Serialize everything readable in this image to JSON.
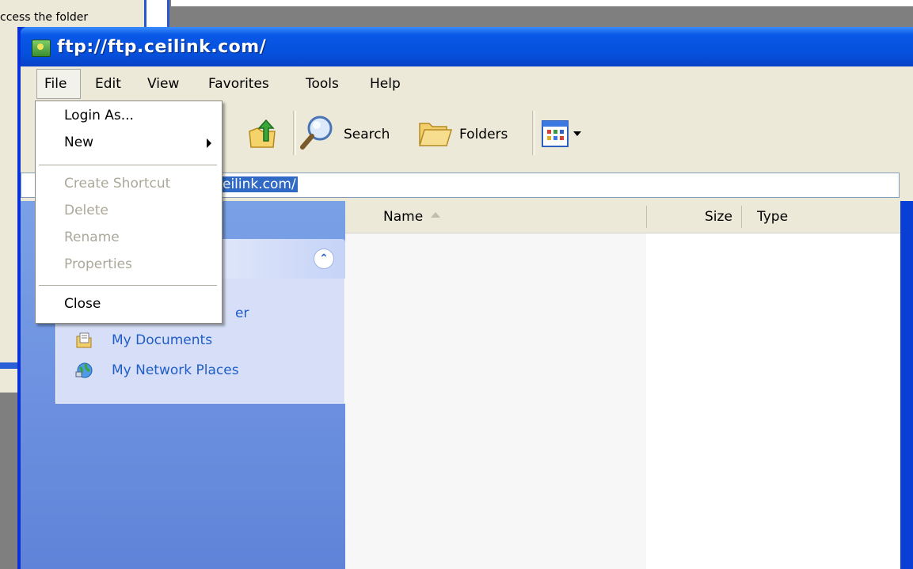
{
  "background_window": {
    "text": "ccess the folder"
  },
  "window": {
    "title": "ftp://ftp.ceilink.com/"
  },
  "menubar": [
    "File",
    "Edit",
    "View",
    "Favorites",
    "Tools",
    "Help"
  ],
  "toolbar": {
    "search_label": "Search",
    "folders_label": "Folders"
  },
  "address": {
    "value": "eilink.com/"
  },
  "file_menu": {
    "items": [
      {
        "label": "Login As..."
      },
      {
        "label": "New"
      },
      {
        "label": "Create Shortcut"
      },
      {
        "label": "Delete"
      },
      {
        "label": "Rename"
      },
      {
        "label": "Properties"
      },
      {
        "label": "Close"
      }
    ]
  },
  "other_places": {
    "partial_item": "er",
    "items": [
      {
        "label": "My Documents"
      },
      {
        "label": "My Network Places"
      }
    ]
  },
  "file_list": {
    "columns": [
      "Name",
      "Size",
      "Type"
    ]
  },
  "colors": {
    "title_blue": "#0a58e8",
    "task_pane_blue": "#6e92e0",
    "highlight": "#316ac5",
    "disabled_text": "#aca899"
  }
}
